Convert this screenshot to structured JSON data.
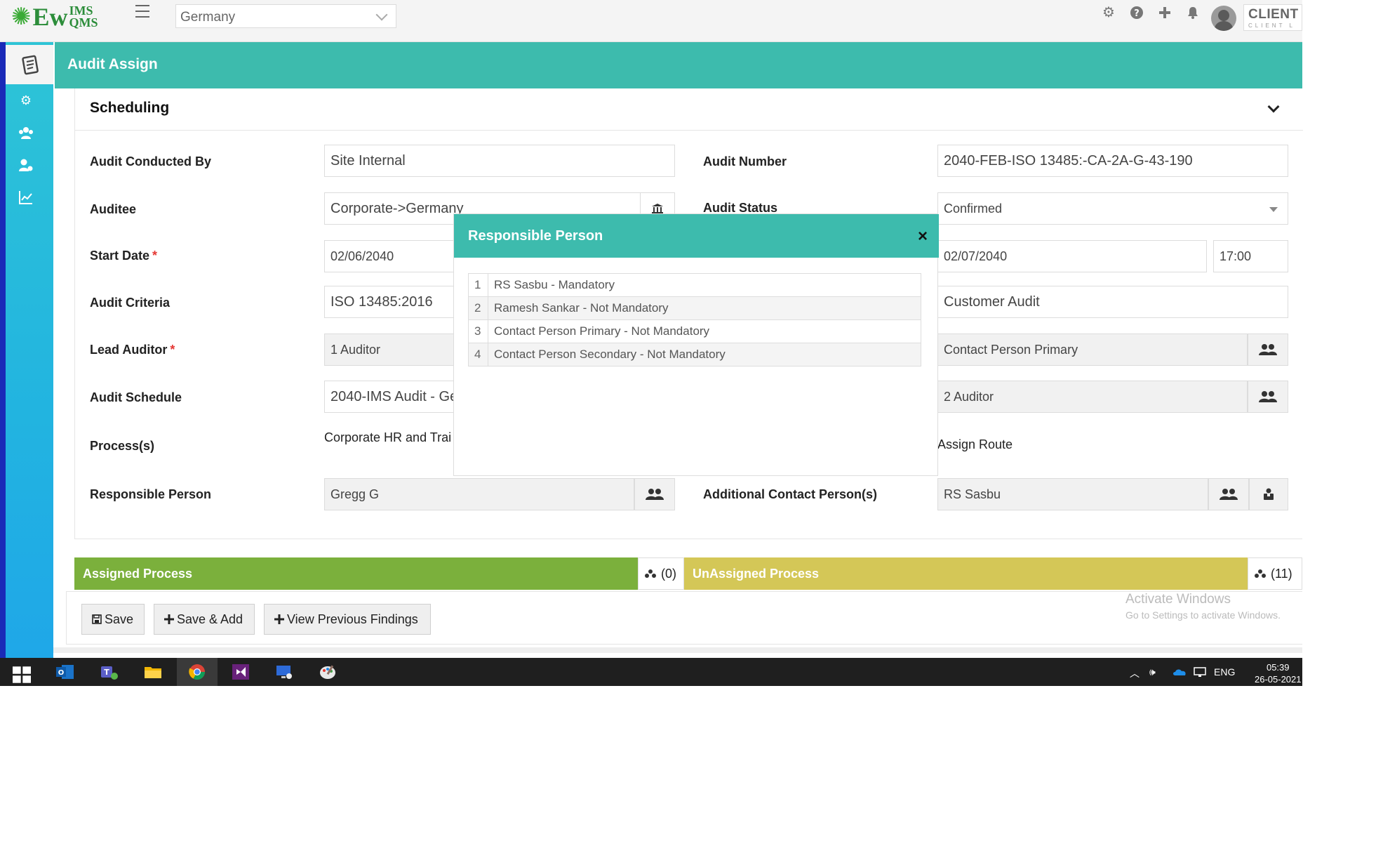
{
  "app": {
    "logo_main": "Ew",
    "logo_top": "IMS",
    "logo_bottom": "QMS",
    "location_select": "Germany",
    "client_name": "CLIENT L",
    "client_sub": "CLIENT L"
  },
  "page": {
    "title": "Audit Assign",
    "section_title": "Scheduling"
  },
  "form": {
    "audit_conducted_by_label": "Audit Conducted By",
    "audit_conducted_by": "Site Internal",
    "audit_number_label": "Audit Number",
    "audit_number": "2040-FEB-ISO 13485:-CA-2A-G-43-190",
    "auditee_label": "Auditee",
    "auditee": "Corporate->Germany",
    "audit_status_label": "Audit Status",
    "audit_status": "Confirmed",
    "start_date_label": "Start Date",
    "start_date": "02/06/2040",
    "end_date": "02/07/2040",
    "end_time": "17:00",
    "audit_criteria_label": "Audit Criteria",
    "audit_criteria": "ISO 13485:2016",
    "audit_type": "Customer Audit",
    "lead_auditor_label": "Lead Auditor",
    "lead_auditor": "1 Auditor",
    "contact_person": "Contact Person Primary",
    "audit_schedule_label": "Audit Schedule",
    "audit_schedule": "2040-IMS Audit - Ge",
    "auditor": "2 Auditor",
    "processes_label": "Process(s)",
    "processes": "Corporate HR and Trai",
    "assign_route": "Assign Route",
    "responsible_person_label": "Responsible Person",
    "responsible_person": "Gregg G",
    "additional_contact_label": "Additional Contact Person(s)",
    "additional_contact": "RS Sasbu",
    "required_mark": "*"
  },
  "process_bars": {
    "assigned_label": "Assigned Process",
    "assigned_count": "(0)",
    "unassigned_label": "UnAssigned Process",
    "unassigned_count": "(11)"
  },
  "actions": {
    "save": "Save",
    "save_add": "Save & Add",
    "view_previous": "View Previous Findings"
  },
  "watermark": {
    "line1": "Activate Windows",
    "line2": "Go to Settings to activate Windows."
  },
  "modal": {
    "title": "Responsible Person",
    "close": "×",
    "rows": [
      {
        "n": "1",
        "text": "RS Sasbu - Mandatory"
      },
      {
        "n": "2",
        "text": "Ramesh Sankar - Not Mandatory"
      },
      {
        "n": "3",
        "text": "Contact Person Primary - Not Mandatory"
      },
      {
        "n": "4",
        "text": "Contact Person Secondary - Not Mandatory"
      }
    ]
  },
  "taskbar": {
    "lang": "ENG",
    "time": "05:39",
    "date": "26-05-2021"
  },
  "colors": {
    "teal": "#3dbbad",
    "assigned_green": "#7bb03c",
    "unassigned_yellow": "#d4c757",
    "sidebar_blue": "#22b4e0"
  }
}
